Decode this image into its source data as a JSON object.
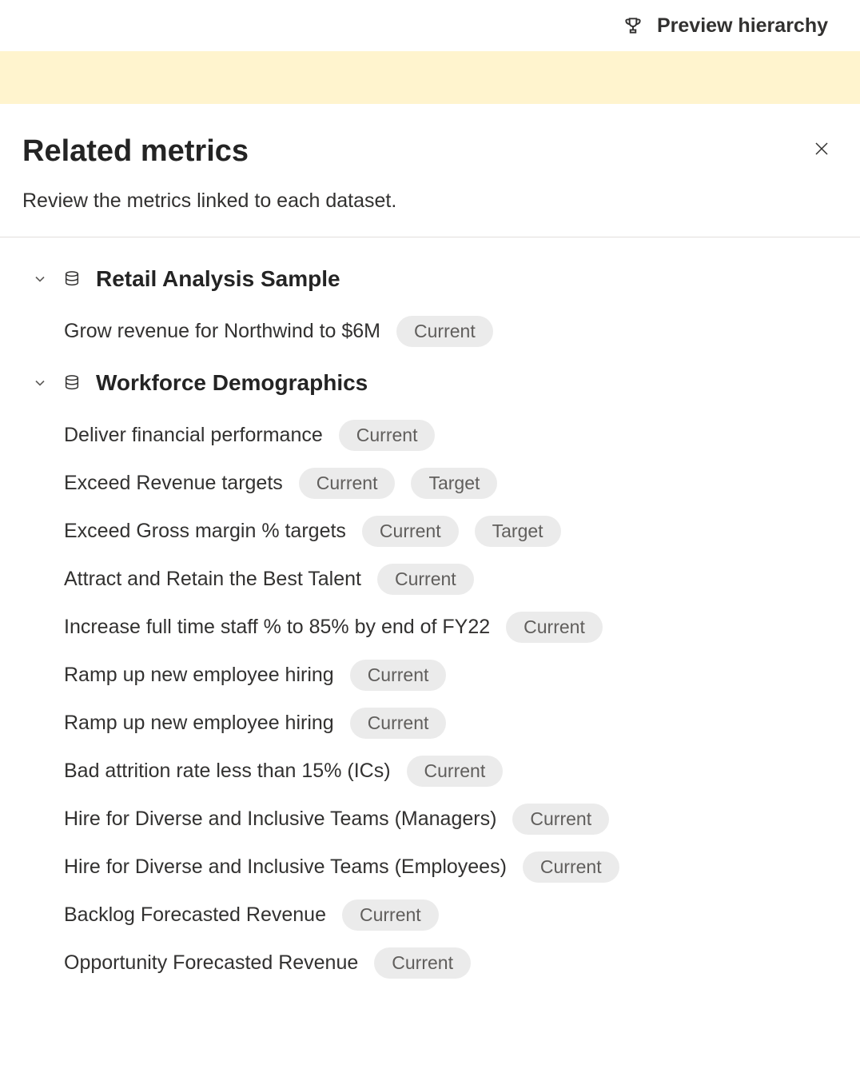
{
  "topbar": {
    "preview_label": "Preview hierarchy"
  },
  "panel": {
    "title": "Related metrics",
    "subtitle": "Review the metrics linked to each dataset."
  },
  "tags": {
    "current": "Current",
    "target": "Target"
  },
  "datasets": [
    {
      "name": "Retail Analysis Sample",
      "metrics": [
        {
          "label": "Grow revenue for Northwind to $6M",
          "tags": [
            "current"
          ]
        }
      ]
    },
    {
      "name": "Workforce Demographics",
      "metrics": [
        {
          "label": "Deliver financial performance",
          "tags": [
            "current"
          ]
        },
        {
          "label": "Exceed Revenue targets",
          "tags": [
            "current",
            "target"
          ]
        },
        {
          "label": "Exceed Gross margin % targets",
          "tags": [
            "current",
            "target"
          ]
        },
        {
          "label": "Attract and Retain the Best Talent",
          "tags": [
            "current"
          ]
        },
        {
          "label": "Increase full time staff % to 85% by end of FY22",
          "tags": [
            "current"
          ]
        },
        {
          "label": "Ramp up new employee hiring",
          "tags": [
            "current"
          ]
        },
        {
          "label": "Ramp up new employee hiring",
          "tags": [
            "current"
          ]
        },
        {
          "label": "Bad attrition rate less than 15% (ICs)",
          "tags": [
            "current"
          ]
        },
        {
          "label": "Hire for Diverse and Inclusive Teams (Managers)",
          "tags": [
            "current"
          ]
        },
        {
          "label": "Hire for Diverse and Inclusive Teams (Employees)",
          "tags": [
            "current"
          ]
        },
        {
          "label": "Backlog Forecasted Revenue",
          "tags": [
            "current"
          ]
        },
        {
          "label": "Opportunity Forecasted Revenue",
          "tags": [
            "current"
          ]
        }
      ]
    }
  ]
}
